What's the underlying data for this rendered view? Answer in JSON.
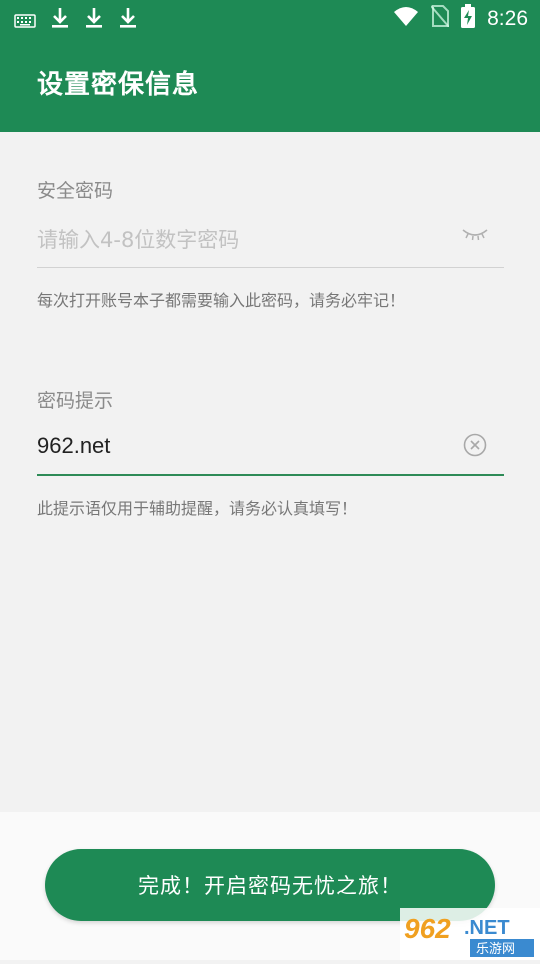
{
  "status_bar": {
    "time": "8:26"
  },
  "app_bar": {
    "title": "设置密保信息"
  },
  "password_field": {
    "label": "安全密码",
    "placeholder": "请输入4-8位数字密码",
    "hint": "每次打开账号本子都需要输入此密码，请务必牢记！"
  },
  "hint_field": {
    "label": "密码提示",
    "value": "962.net",
    "hint": "此提示语仅用于辅助提醒，请务必认真填写！"
  },
  "done_button": {
    "label": "完成！开启密码无忧之旅！"
  },
  "watermark": {
    "brand": "962.NET",
    "sub": "乐游网"
  },
  "colors": {
    "primary": "#1e8a55",
    "background": "#f2f2f2"
  },
  "icons": [
    "keyboard-icon",
    "download-icon",
    "wifi-icon",
    "no-sim-icon",
    "battery-charging-icon",
    "eye-closed-icon",
    "clear-icon"
  ]
}
